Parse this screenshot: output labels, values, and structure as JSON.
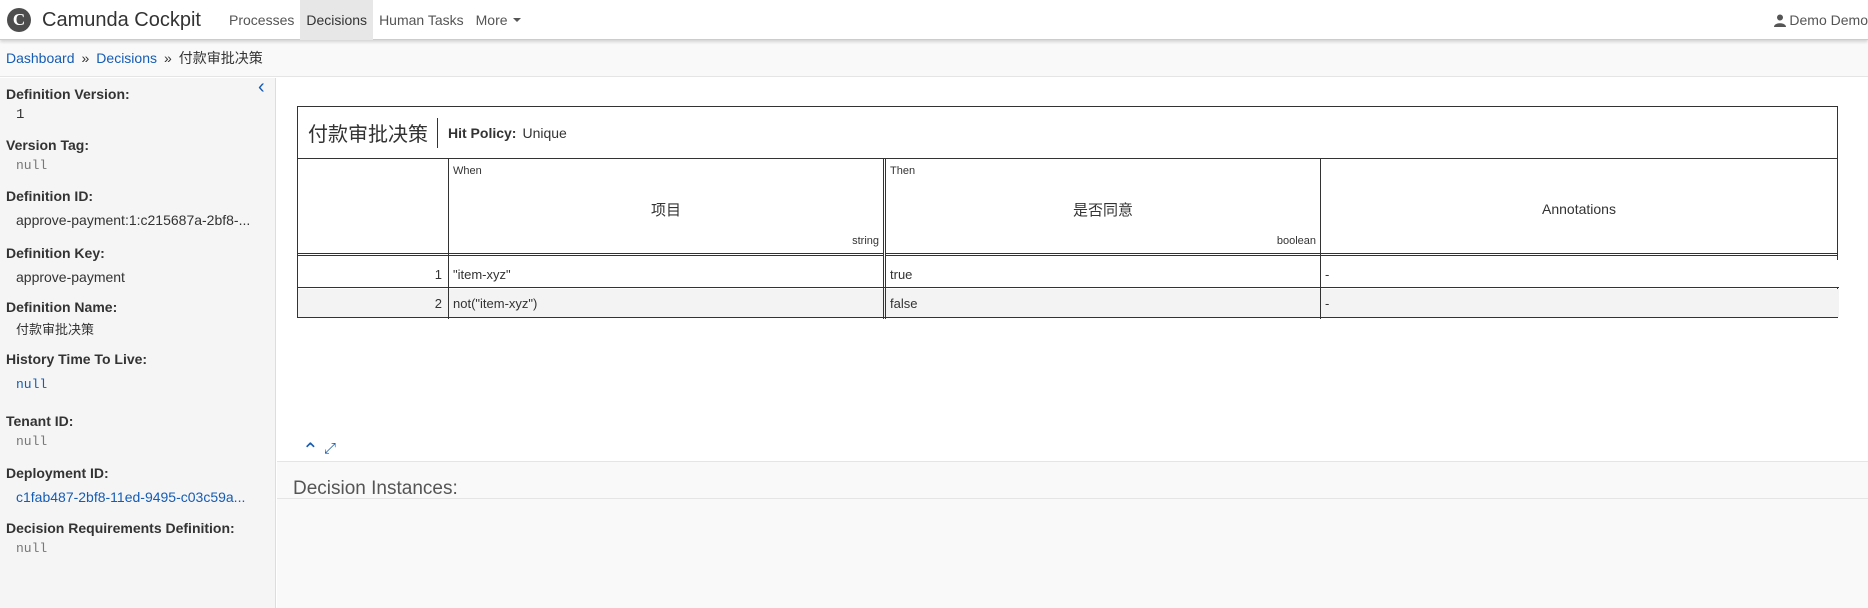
{
  "app": {
    "logo_glyph": "C",
    "brand": "Camunda Cockpit"
  },
  "nav": {
    "items": [
      {
        "label": "Processes"
      },
      {
        "label": "Decisions"
      },
      {
        "label": "Human Tasks"
      },
      {
        "label": "More"
      }
    ],
    "active": "Decisions",
    "user": "Demo Demo"
  },
  "breadcrumb": {
    "items": [
      "Dashboard",
      "Decisions",
      "付款审批决策"
    ],
    "separator": "»"
  },
  "sidebar": {
    "collapse_glyph": "‹",
    "fields": [
      {
        "label": "Definition Version:",
        "value": "1"
      },
      {
        "label": "Version Tag:",
        "value": "null"
      },
      {
        "label": "Definition ID:",
        "value": "approve-payment:1:c215687a-2bf8-..."
      },
      {
        "label": "Definition Key:",
        "value": "approve-payment"
      },
      {
        "label": "Definition Name:",
        "value": "付款审批决策"
      },
      {
        "label": "History Time To Live:",
        "value": "null"
      },
      {
        "label": "Tenant ID:",
        "value": "null"
      },
      {
        "label": "Deployment ID:",
        "value": "c1fab487-2bf8-11ed-9495-c03c59a..."
      },
      {
        "label": "Decision Requirements Definition:",
        "value": "null"
      }
    ]
  },
  "decision_table": {
    "name": "付款审批决策",
    "hit_policy_label": "Hit Policy:",
    "hit_policy": "Unique",
    "input": {
      "kind": "When",
      "title": "项目",
      "type": "string"
    },
    "output": {
      "kind": "Then",
      "title": "是否同意",
      "type": "boolean"
    },
    "annotations_title": "Annotations",
    "rows": [
      {
        "num": "1",
        "input": "\"item-xyz\"",
        "output": "true",
        "annotation": "-"
      },
      {
        "num": "2",
        "input": "not(\"item-xyz\")",
        "output": "false",
        "annotation": "-"
      }
    ]
  },
  "controls": {
    "collapse_up_glyph": "⌃",
    "expand_glyph": "⤢"
  },
  "instances": {
    "title": "Decision Instances:"
  },
  "colors": {
    "link": "#155cb5",
    "sidebar_bg": "#f5f5f5",
    "active_nav_bg": "#e7e7e7"
  }
}
